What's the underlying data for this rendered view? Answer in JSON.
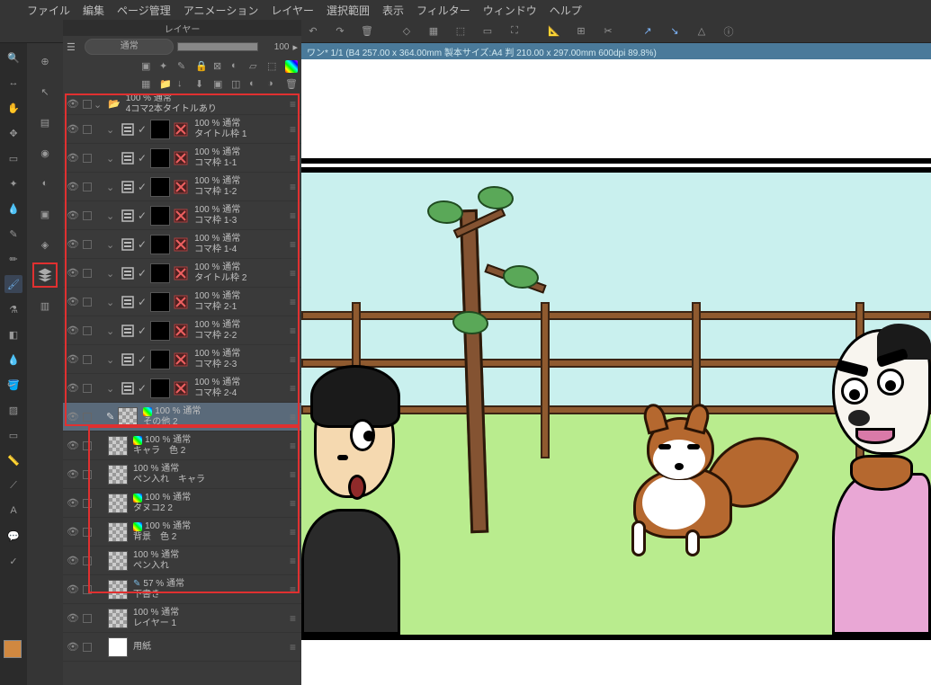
{
  "app_icon": "clip-studio",
  "menubar": [
    "ファイル",
    "編集",
    "ページ管理",
    "アニメーション",
    "レイヤー",
    "選択範囲",
    "表示",
    "フィルター",
    "ウィンドウ",
    "ヘルプ"
  ],
  "infobar": "ワン* 1/1 (B4 257.00 x 364.00mm 製本サイズ:A4 判 210.00 x 297.00mm 600dpi 89.8%)",
  "layer_panel": {
    "title": "レイヤー",
    "blend_mode": "通常",
    "opacity": "100"
  },
  "layers": [
    {
      "indent": 0,
      "type": "folder",
      "opacity": "100 % 通常",
      "name": "4コマ2本タイトルあり",
      "chev": true,
      "thumb": "none"
    },
    {
      "indent": 1,
      "type": "frame",
      "opacity": "100 % 通常",
      "name": "タイトル枠 1",
      "chev": true,
      "mask": true
    },
    {
      "indent": 1,
      "type": "frame",
      "opacity": "100 % 通常",
      "name": "コマ枠 1-1",
      "chev": true,
      "mask": true
    },
    {
      "indent": 1,
      "type": "frame",
      "opacity": "100 % 通常",
      "name": "コマ枠 1-2",
      "chev": true,
      "mask": true
    },
    {
      "indent": 1,
      "type": "frame",
      "opacity": "100 % 通常",
      "name": "コマ枠 1-3",
      "chev": true,
      "mask": true
    },
    {
      "indent": 1,
      "type": "frame",
      "opacity": "100 % 通常",
      "name": "コマ枠 1-4",
      "chev": true,
      "mask": true
    },
    {
      "indent": 1,
      "type": "frame",
      "opacity": "100 % 通常",
      "name": "タイトル枠 2",
      "chev": true,
      "mask": true
    },
    {
      "indent": 1,
      "type": "frame",
      "opacity": "100 % 通常",
      "name": "コマ枠 2-1",
      "chev": true,
      "mask": true
    },
    {
      "indent": 1,
      "type": "frame",
      "opacity": "100 % 通常",
      "name": "コマ枠 2-2",
      "chev": true,
      "mask": true
    },
    {
      "indent": 1,
      "type": "frame",
      "opacity": "100 % 通常",
      "name": "コマ枠 2-3",
      "chev": true,
      "mask": true
    },
    {
      "indent": 1,
      "type": "frame",
      "opacity": "100 % 通常",
      "name": "コマ枠 2-4",
      "chev": true,
      "mask": true
    },
    {
      "indent": 1,
      "type": "raster",
      "opacity": "100 % 通常",
      "name": "その他 2",
      "thumb": "checker",
      "palette": true,
      "selected": true,
      "active": true
    },
    {
      "indent": 1,
      "type": "raster",
      "opacity": "100 % 通常",
      "name": "キャラ　色 2",
      "thumb": "checker",
      "palette": true
    },
    {
      "indent": 1,
      "type": "raster",
      "opacity": "100 % 通常",
      "name": "ペン入れ　キャラ",
      "thumb": "checker"
    },
    {
      "indent": 1,
      "type": "raster",
      "opacity": "100 % 通常",
      "name": "タヌコ2 2",
      "thumb": "checker",
      "palette": true
    },
    {
      "indent": 1,
      "type": "raster",
      "opacity": "100 % 通常",
      "name": "背景　色 2",
      "thumb": "checker",
      "palette": true
    },
    {
      "indent": 1,
      "type": "raster",
      "opacity": "100 % 通常",
      "name": "ペン入れ",
      "thumb": "checker"
    },
    {
      "indent": 1,
      "type": "raster",
      "opacity": "57 % 通常",
      "name": "下書き",
      "thumb": "checker",
      "draft": true
    },
    {
      "indent": 1,
      "type": "raster",
      "opacity": "100 % 通常",
      "name": "レイヤー 1",
      "thumb": "checker"
    },
    {
      "indent": 1,
      "type": "paper",
      "opacity": "",
      "name": "用紙",
      "thumb": "white"
    }
  ]
}
